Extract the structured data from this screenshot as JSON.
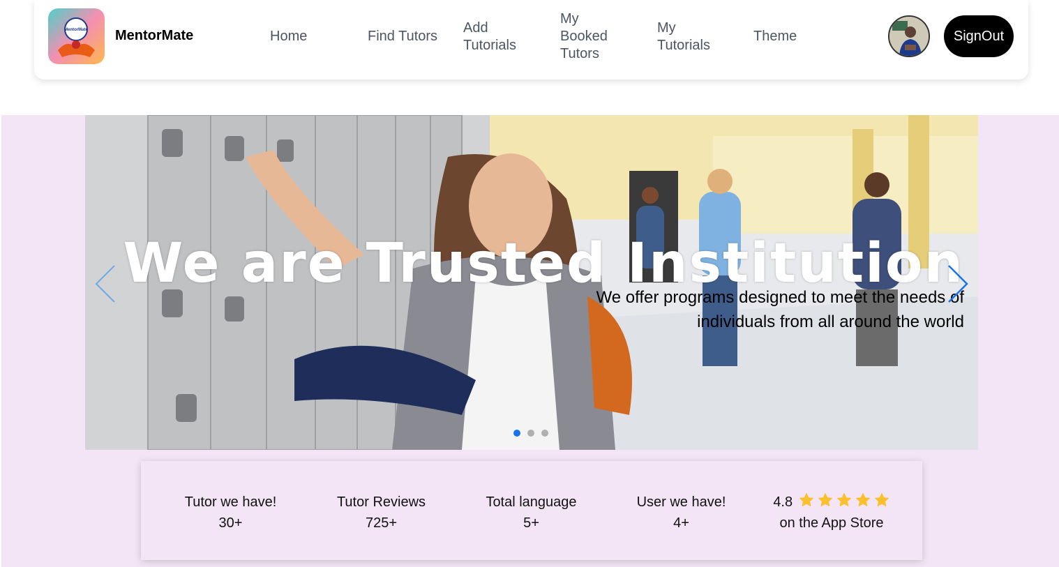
{
  "brand": {
    "name": "MentorMate",
    "logo_text": "MentorMate"
  },
  "nav": {
    "home": "Home",
    "find_tutors": "Find Tutors",
    "add_tutorials": "Add\nTutorials",
    "my_booked_tutors": "My\nBooked\nTutors",
    "my_tutorials": "My\nTutorials",
    "theme": "Theme"
  },
  "signout_label": "SignOut",
  "hero": {
    "title": "We are Trusted Institution",
    "subtitle": "We offer programs designed to meet the needs of individuals from all around the world",
    "slides_count": 3,
    "active_slide": 1
  },
  "stats": [
    {
      "label": "Tutor we have!",
      "value": "30+"
    },
    {
      "label": "Tutor Reviews",
      "value": "725+"
    },
    {
      "label": "Total language",
      "value": "5+"
    },
    {
      "label": "User we have!",
      "value": "4+"
    }
  ],
  "rating": {
    "value": "4.8",
    "stars": 5,
    "caption": "on the App Store"
  },
  "colors": {
    "accent": "#1a73e8",
    "section_bg": "#f3e5f5",
    "button_bg": "#000000",
    "star": "#fbc02d",
    "nav_text": "#4b5563"
  }
}
